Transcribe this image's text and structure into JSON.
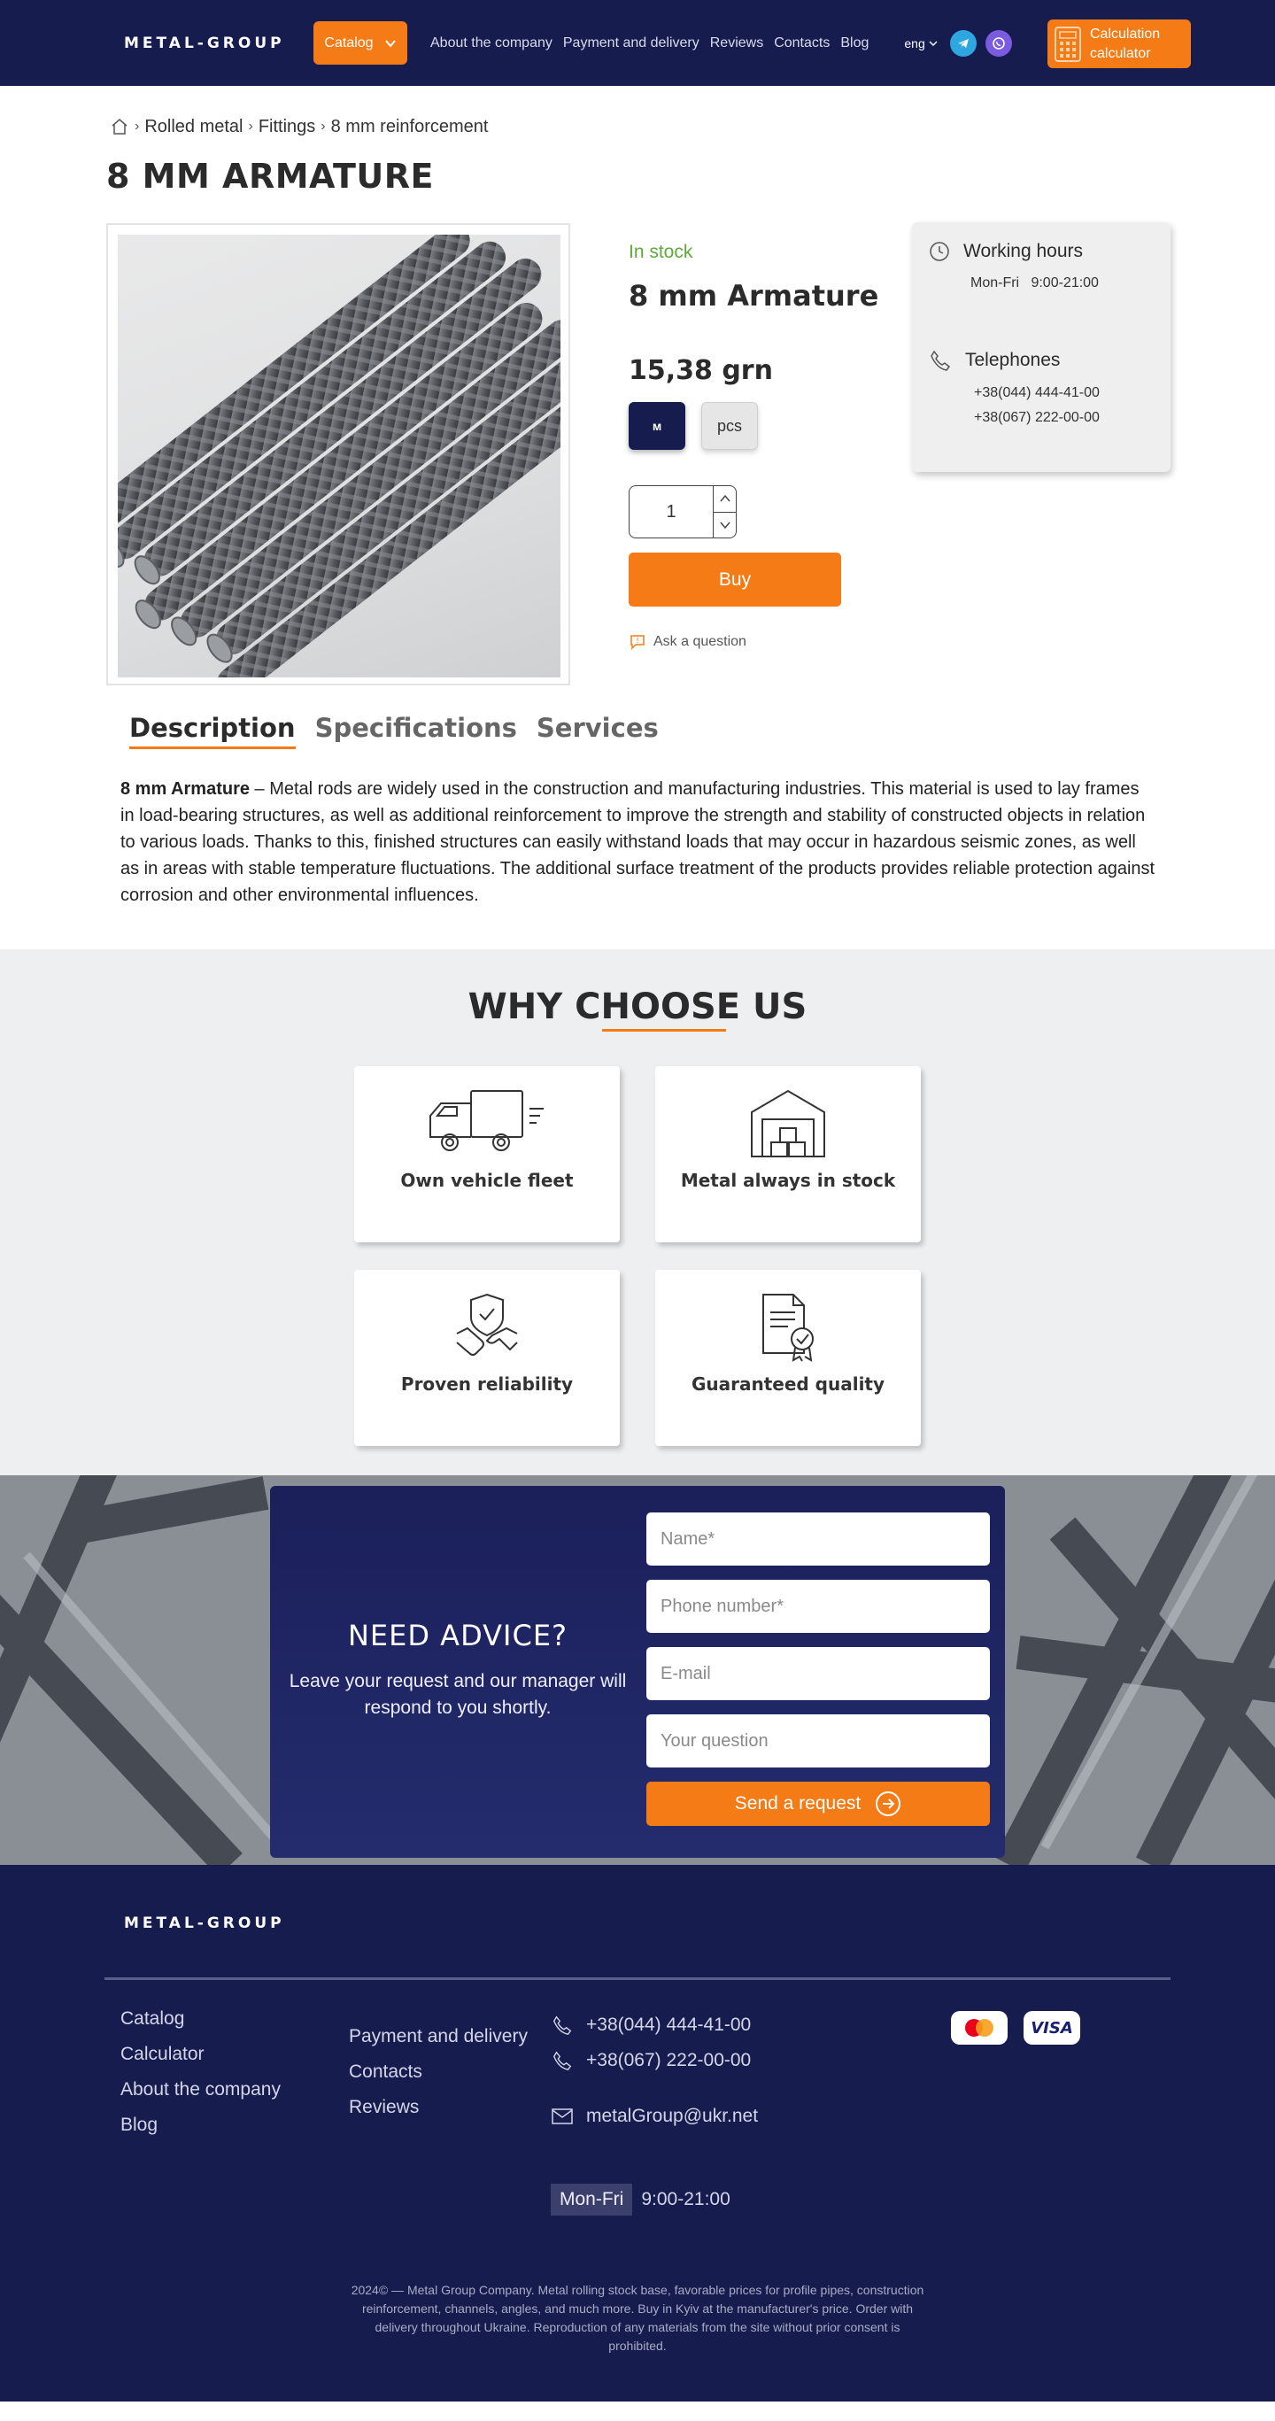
{
  "header": {
    "logo": "METAL-GROUP",
    "catalog_label": "Catalog",
    "nav": [
      "About the company",
      "Payment and delivery",
      "Reviews",
      "Contacts",
      "Blog"
    ],
    "lang": "eng",
    "calc_line1": "Calculation",
    "calc_line2": "calculator"
  },
  "breadcrumb": {
    "items": [
      "Rolled metal",
      "Fittings",
      "8 mm reinforcement"
    ]
  },
  "page_title": "8 MM ARMATURE",
  "product": {
    "stock": "In stock",
    "name": "8 mm Armature",
    "price": "15,38 grn",
    "unit_active": "м",
    "unit_inactive": "pcs",
    "quantity": "1",
    "buy_label": "Buy",
    "ask_label": "Ask a question"
  },
  "contact_card": {
    "hours_title": "Working hours",
    "hours_value": "Mon-Fri   9:00-21:00",
    "tel_title": "Telephones",
    "phones": [
      "+38(044) 444-41-00",
      "+38(067) 222-00-00"
    ]
  },
  "tabs": [
    "Description",
    "Specifications",
    "Services"
  ],
  "description": {
    "bold": "8 mm Armature",
    "text": " – Metal rods are widely used in the construction and manufacturing industries. This material is used to lay frames in load-bearing structures, as well as additional reinforcement to improve the strength and stability of constructed objects in relation to various loads. Thanks to this, finished structures can easily withstand loads that may occur in hazardous seismic zones, as well as in areas with stable temperature fluctuations. The additional surface treatment of the products provides reliable protection against corrosion and other environmental influences."
  },
  "why": {
    "title": "WHY CHOOSE US",
    "features": [
      "Own vehicle fleet",
      "Metal always in stock",
      "Proven reliability",
      "Guaranteed quality"
    ]
  },
  "advice": {
    "title": "NEED ADVICE?",
    "text": "Leave your request and our manager will respond to you shortly.",
    "placeholders": [
      "Name*",
      "Phone number*",
      "E-mail",
      "Your question"
    ],
    "send_label": "Send a request"
  },
  "footer": {
    "logo": "METAL-GROUP",
    "col1": [
      "Catalog",
      "Calculator",
      "About the company",
      "Blog"
    ],
    "col2": [
      "Payment and delivery",
      "Contacts",
      "Reviews"
    ],
    "phones": [
      "+38(044) 444-41-00",
      "+38(067) 222-00-00"
    ],
    "email": "metalGroup@ukr.net",
    "hours_days": "Mon-Fri",
    "hours_time": "9:00-21:00",
    "visa": "VISA",
    "copyright": "2024© — Metal Group Company. Metal rolling stock base, favorable prices for profile pipes, construction reinforcement, channels, angles, and much more. Buy in Kyiv at the manufacturer's price. Order with delivery throughout Ukraine. Reproduction of any materials from the site without prior consent is prohibited."
  },
  "colors": {
    "navy": "#171c4e",
    "orange": "#f47b16",
    "green": "#5da93a"
  }
}
